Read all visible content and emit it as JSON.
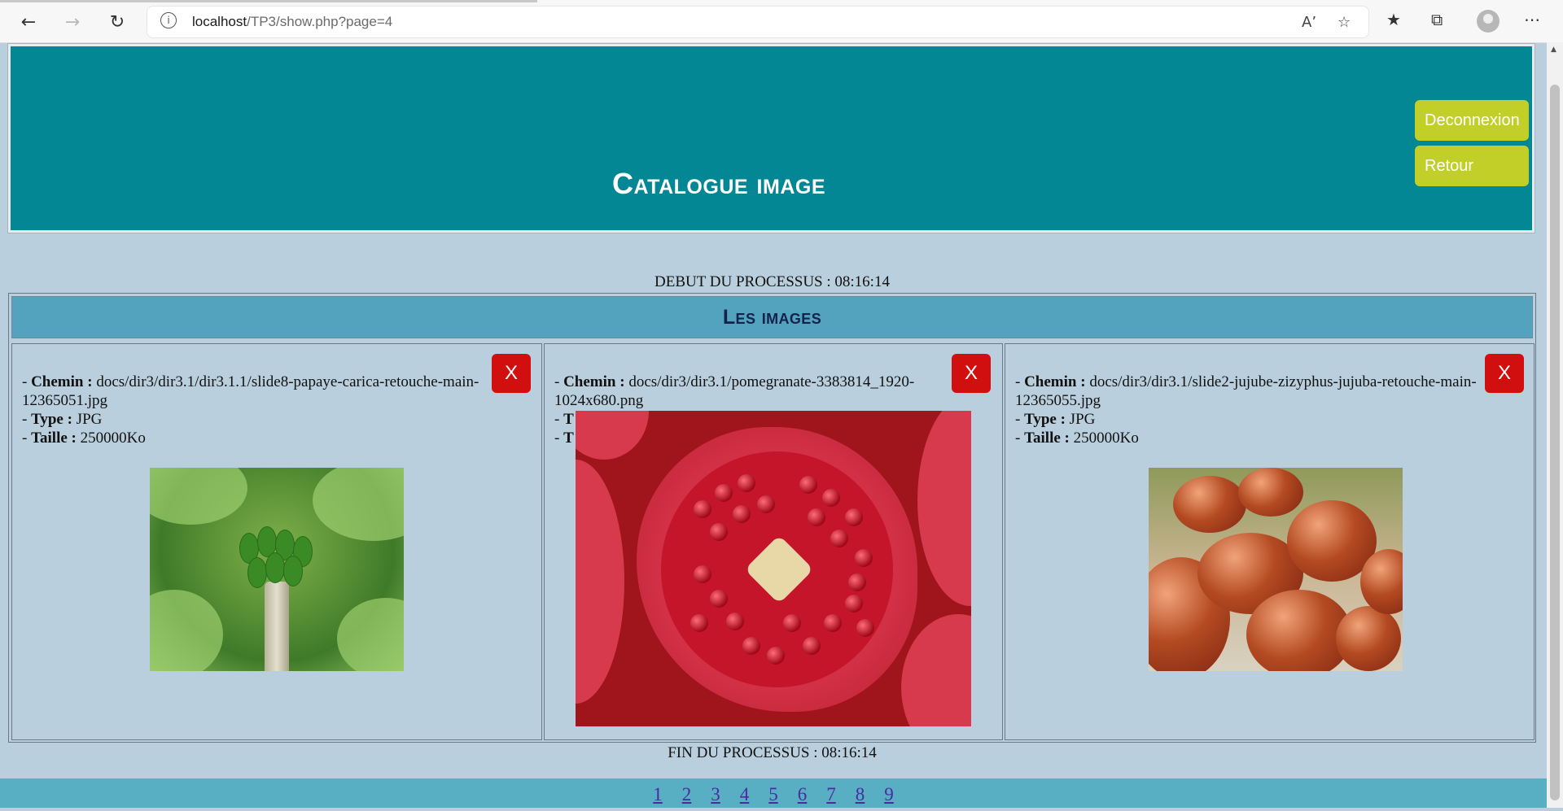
{
  "browser": {
    "url_host": "localhost",
    "url_path": "/TP3/show.php?page=4"
  },
  "header": {
    "title": "Catalogue image",
    "logout_label": "Deconnexion",
    "back_label": "Retour"
  },
  "process": {
    "start": "DEBUT DU PROCESSUS : 08:16:14",
    "end": "FIN DU PROCESSUS : 08:16:14"
  },
  "gallery": {
    "heading": "Les images",
    "labels": {
      "path": "Chemin :",
      "type": "Type :",
      "size": "Taille :"
    },
    "delete_label": "X",
    "items": [
      {
        "path": "docs/dir3/dir3.1/dir3.1.1/slide8-papaye-carica-retouche-main-12365051.jpg",
        "type": "JPG",
        "size": "250000Ko"
      },
      {
        "path": "docs/dir3/dir3.1/pomegranate-3383814_1920-1024x680.png",
        "type": "",
        "size": ""
      },
      {
        "path": "docs/dir3/dir3.1/slide2-jujube-zizyphus-jujuba-retouche-main-12365055.jpg",
        "type": "JPG",
        "size": "250000Ko"
      }
    ]
  },
  "pagination": [
    "1",
    "2",
    "3",
    "4",
    "5",
    "6",
    "7",
    "8",
    "9"
  ],
  "colors": {
    "page_bg": "#b9cfdd",
    "header_bg": "#038795",
    "header_button": "#c2cf28",
    "gallery_head_bg": "#53a2be",
    "delete_button": "#d20f0f"
  }
}
